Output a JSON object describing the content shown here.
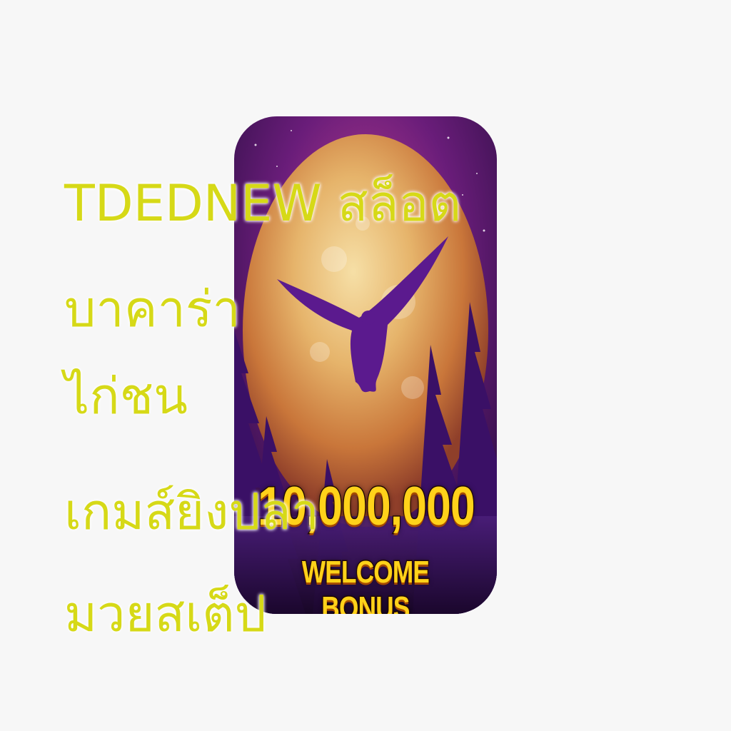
{
  "banner": {
    "amount_text": "10,000,000",
    "subtitle_text": "WELCOME BONUS",
    "image_name": "full-moon-eagle-slot-banner"
  },
  "overlay_lines": [
    "TDEDNEW สล็อต",
    "บาคาร่า",
    "ไก่ชน",
    "เกมส์ยิงปลา",
    "มวยสเต็ป"
  ],
  "colors": {
    "background": "#f7f7f7",
    "overlay_text": "#d6d917",
    "bonus_text": "#ffd21a",
    "eagle": "#5b1a8e",
    "sky": "#6a1d7a",
    "moon": "#e6b46b"
  }
}
